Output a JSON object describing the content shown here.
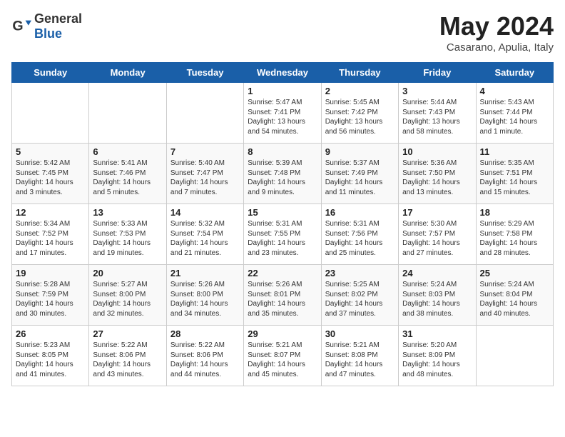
{
  "header": {
    "logo_general": "General",
    "logo_blue": "Blue",
    "title": "May 2024",
    "location": "Casarano, Apulia, Italy"
  },
  "days_of_week": [
    "Sunday",
    "Monday",
    "Tuesday",
    "Wednesday",
    "Thursday",
    "Friday",
    "Saturday"
  ],
  "weeks": [
    [
      {
        "date": "",
        "text": ""
      },
      {
        "date": "",
        "text": ""
      },
      {
        "date": "",
        "text": ""
      },
      {
        "date": "1",
        "text": "Sunrise: 5:47 AM\nSunset: 7:41 PM\nDaylight: 13 hours\nand 54 minutes."
      },
      {
        "date": "2",
        "text": "Sunrise: 5:45 AM\nSunset: 7:42 PM\nDaylight: 13 hours\nand 56 minutes."
      },
      {
        "date": "3",
        "text": "Sunrise: 5:44 AM\nSunset: 7:43 PM\nDaylight: 13 hours\nand 58 minutes."
      },
      {
        "date": "4",
        "text": "Sunrise: 5:43 AM\nSunset: 7:44 PM\nDaylight: 14 hours\nand 1 minute."
      }
    ],
    [
      {
        "date": "5",
        "text": "Sunrise: 5:42 AM\nSunset: 7:45 PM\nDaylight: 14 hours\nand 3 minutes."
      },
      {
        "date": "6",
        "text": "Sunrise: 5:41 AM\nSunset: 7:46 PM\nDaylight: 14 hours\nand 5 minutes."
      },
      {
        "date": "7",
        "text": "Sunrise: 5:40 AM\nSunset: 7:47 PM\nDaylight: 14 hours\nand 7 minutes."
      },
      {
        "date": "8",
        "text": "Sunrise: 5:39 AM\nSunset: 7:48 PM\nDaylight: 14 hours\nand 9 minutes."
      },
      {
        "date": "9",
        "text": "Sunrise: 5:37 AM\nSunset: 7:49 PM\nDaylight: 14 hours\nand 11 minutes."
      },
      {
        "date": "10",
        "text": "Sunrise: 5:36 AM\nSunset: 7:50 PM\nDaylight: 14 hours\nand 13 minutes."
      },
      {
        "date": "11",
        "text": "Sunrise: 5:35 AM\nSunset: 7:51 PM\nDaylight: 14 hours\nand 15 minutes."
      }
    ],
    [
      {
        "date": "12",
        "text": "Sunrise: 5:34 AM\nSunset: 7:52 PM\nDaylight: 14 hours\nand 17 minutes."
      },
      {
        "date": "13",
        "text": "Sunrise: 5:33 AM\nSunset: 7:53 PM\nDaylight: 14 hours\nand 19 minutes."
      },
      {
        "date": "14",
        "text": "Sunrise: 5:32 AM\nSunset: 7:54 PM\nDaylight: 14 hours\nand 21 minutes."
      },
      {
        "date": "15",
        "text": "Sunrise: 5:31 AM\nSunset: 7:55 PM\nDaylight: 14 hours\nand 23 minutes."
      },
      {
        "date": "16",
        "text": "Sunrise: 5:31 AM\nSunset: 7:56 PM\nDaylight: 14 hours\nand 25 minutes."
      },
      {
        "date": "17",
        "text": "Sunrise: 5:30 AM\nSunset: 7:57 PM\nDaylight: 14 hours\nand 27 minutes."
      },
      {
        "date": "18",
        "text": "Sunrise: 5:29 AM\nSunset: 7:58 PM\nDaylight: 14 hours\nand 28 minutes."
      }
    ],
    [
      {
        "date": "19",
        "text": "Sunrise: 5:28 AM\nSunset: 7:59 PM\nDaylight: 14 hours\nand 30 minutes."
      },
      {
        "date": "20",
        "text": "Sunrise: 5:27 AM\nSunset: 8:00 PM\nDaylight: 14 hours\nand 32 minutes."
      },
      {
        "date": "21",
        "text": "Sunrise: 5:26 AM\nSunset: 8:00 PM\nDaylight: 14 hours\nand 34 minutes."
      },
      {
        "date": "22",
        "text": "Sunrise: 5:26 AM\nSunset: 8:01 PM\nDaylight: 14 hours\nand 35 minutes."
      },
      {
        "date": "23",
        "text": "Sunrise: 5:25 AM\nSunset: 8:02 PM\nDaylight: 14 hours\nand 37 minutes."
      },
      {
        "date": "24",
        "text": "Sunrise: 5:24 AM\nSunset: 8:03 PM\nDaylight: 14 hours\nand 38 minutes."
      },
      {
        "date": "25",
        "text": "Sunrise: 5:24 AM\nSunset: 8:04 PM\nDaylight: 14 hours\nand 40 minutes."
      }
    ],
    [
      {
        "date": "26",
        "text": "Sunrise: 5:23 AM\nSunset: 8:05 PM\nDaylight: 14 hours\nand 41 minutes."
      },
      {
        "date": "27",
        "text": "Sunrise: 5:22 AM\nSunset: 8:06 PM\nDaylight: 14 hours\nand 43 minutes."
      },
      {
        "date": "28",
        "text": "Sunrise: 5:22 AM\nSunset: 8:06 PM\nDaylight: 14 hours\nand 44 minutes."
      },
      {
        "date": "29",
        "text": "Sunrise: 5:21 AM\nSunset: 8:07 PM\nDaylight: 14 hours\nand 45 minutes."
      },
      {
        "date": "30",
        "text": "Sunrise: 5:21 AM\nSunset: 8:08 PM\nDaylight: 14 hours\nand 47 minutes."
      },
      {
        "date": "31",
        "text": "Sunrise: 5:20 AM\nSunset: 8:09 PM\nDaylight: 14 hours\nand 48 minutes."
      },
      {
        "date": "",
        "text": ""
      }
    ]
  ]
}
